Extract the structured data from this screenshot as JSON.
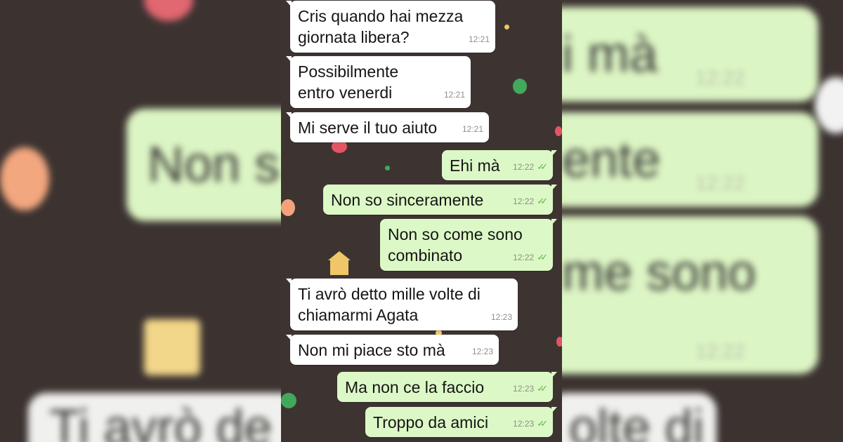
{
  "background_preview": {
    "left_text": "Non s",
    "right_top": "i mà",
    "right_mid": "ente",
    "right_lower": "me sono",
    "right_lower2": "o",
    "bottom_left": "Ti avrò de",
    "bottom_right": "olte di",
    "time": "12:22"
  },
  "messages": [
    {
      "dir": "in",
      "text": "Cris quando hai mezza giornata libera?",
      "time": "12:21"
    },
    {
      "dir": "in",
      "text": "Possibilmente entro venerdi",
      "time": "12:21"
    },
    {
      "dir": "in",
      "text": "Mi serve il tuo aiuto",
      "time": "12:21"
    },
    {
      "dir": "out",
      "text": "Ehi mà",
      "time": "12:22",
      "ticks": "✓✓"
    },
    {
      "dir": "out",
      "text": "Non so sinceramente",
      "time": "12:22",
      "ticks": "✓✓"
    },
    {
      "dir": "out",
      "text": "Non so come sono combinato",
      "time": "12:22",
      "ticks": "✓✓"
    },
    {
      "dir": "in",
      "text": "Ti avrò detto mille volte di chiamarmi Agata",
      "time": "12:23"
    },
    {
      "dir": "in",
      "text": "Non mi piace sto mà",
      "time": "12:23"
    },
    {
      "dir": "out",
      "text": "Ma non ce la faccio",
      "time": "12:23",
      "ticks": "✓✓"
    },
    {
      "dir": "out",
      "text": "Troppo da amici",
      "time": "12:23",
      "ticks": "✓✓"
    }
  ],
  "colors": {
    "incoming_bubble": "#ffffff",
    "outgoing_bubble": "#dcf8c6",
    "chat_background": "#3d3432",
    "read_ticks": "#5ab74a"
  }
}
